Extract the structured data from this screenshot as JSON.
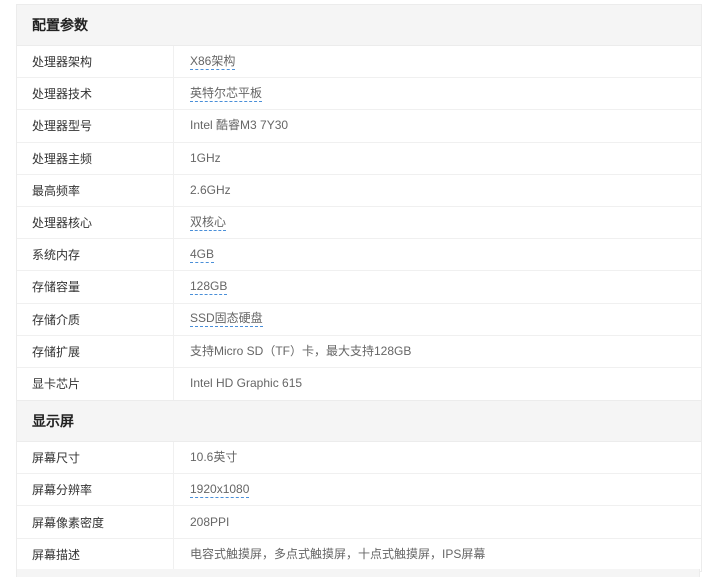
{
  "sections": [
    {
      "title": "配置参数",
      "rows": [
        {
          "label": "处理器架构",
          "value": "X86架构",
          "link": true
        },
        {
          "label": "处理器技术",
          "value": "英特尔芯平板",
          "link": true
        },
        {
          "label": "处理器型号",
          "value": "Intel 酷睿M3 7Y30",
          "link": false
        },
        {
          "label": "处理器主频",
          "value": "1GHz",
          "link": false
        },
        {
          "label": "最高频率",
          "value": "2.6GHz",
          "link": false
        },
        {
          "label": "处理器核心",
          "value": "双核心",
          "link": true
        },
        {
          "label": "系统内存",
          "value": "4GB",
          "link": true
        },
        {
          "label": "存储容量",
          "value": "128GB",
          "link": true
        },
        {
          "label": "存储介质",
          "value": "SSD固态硬盘",
          "link": true
        },
        {
          "label": "存储扩展",
          "value": "支持Micro SD（TF）卡，最大支持128GB",
          "link": false
        },
        {
          "label": "显卡芯片",
          "value": "Intel HD Graphic 615",
          "link": false
        }
      ]
    },
    {
      "title": "显示屏",
      "rows": [
        {
          "label": "屏幕尺寸",
          "value": "10.6英寸",
          "link": false
        },
        {
          "label": "屏幕分辨率",
          "value": "1920x1080",
          "link": true
        },
        {
          "label": "屏幕像素密度",
          "value": "208PPI",
          "link": false
        },
        {
          "label": "屏幕描述",
          "value": "电容式触摸屏，多点式触摸屏，十点式触摸屏，IPS屏幕",
          "link": false
        }
      ]
    }
  ]
}
